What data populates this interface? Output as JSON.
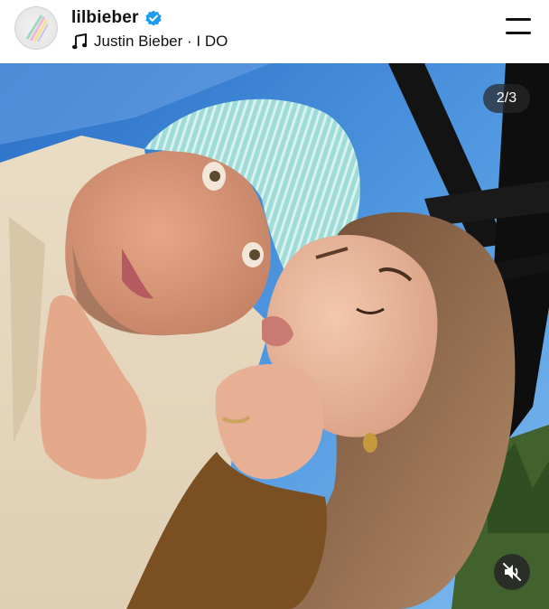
{
  "post": {
    "username": "lilbieber",
    "song": "Justin Bieber · I DO",
    "slide_counter": "2/3"
  },
  "icons": {
    "avatar": "avatar",
    "verified": "verified-badge-icon",
    "music": "music-note-icon",
    "menu": "menu-icon",
    "mute": "muted-speaker-icon"
  },
  "colors": {
    "verified_blue": "#1d9bf0",
    "sky": "#3f86d8",
    "beanie": "#8fd6d4"
  }
}
